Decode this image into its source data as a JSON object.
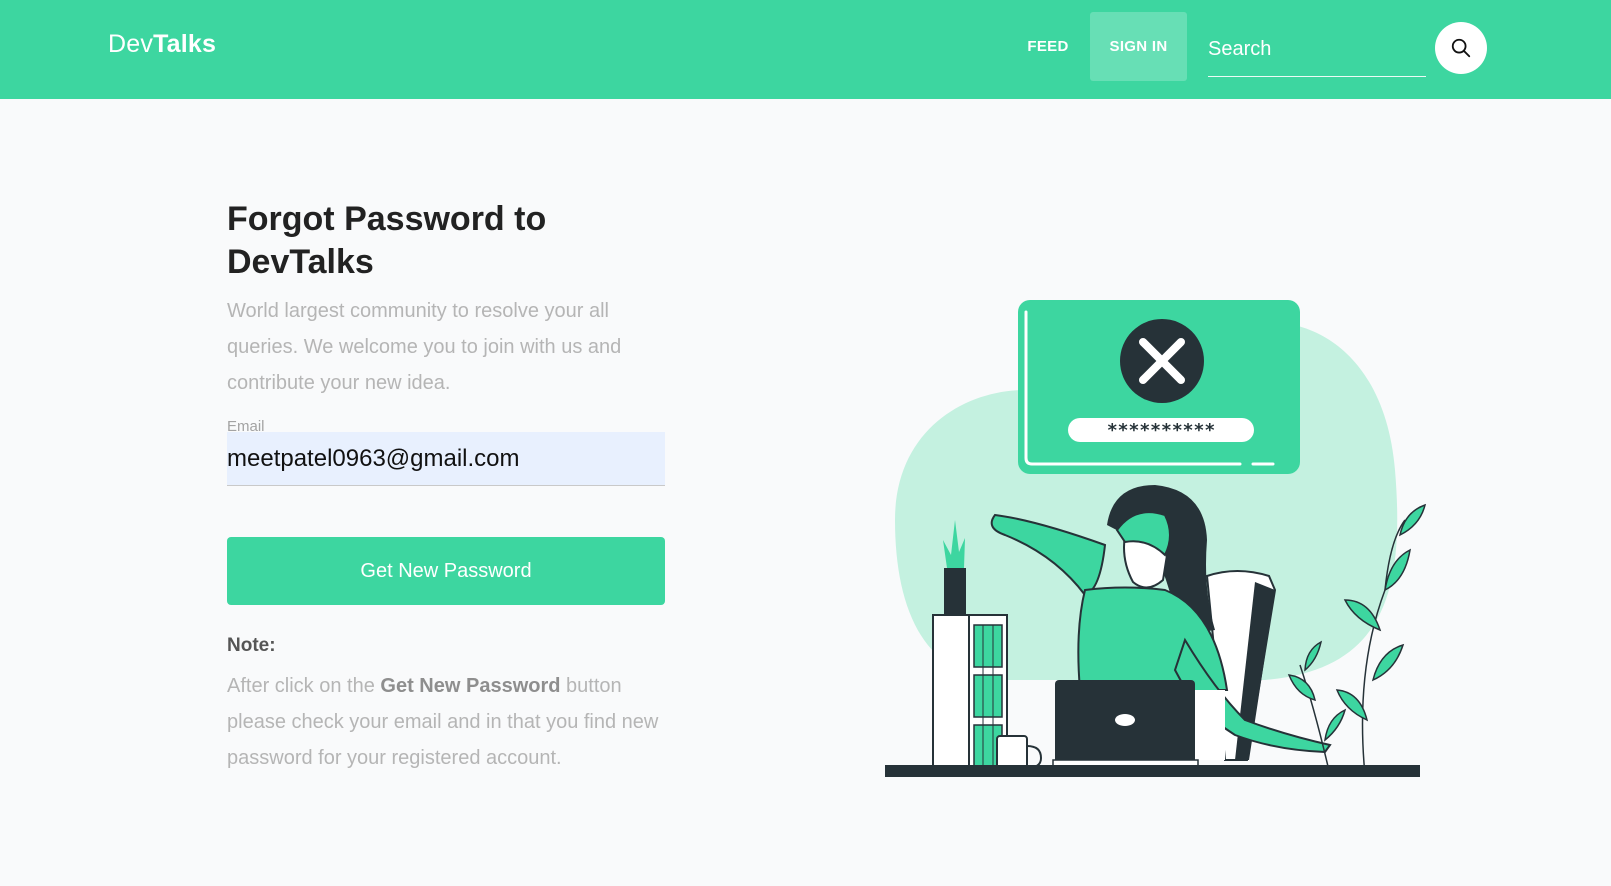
{
  "navbar": {
    "brand_part1": "Dev",
    "brand_part2": "Talks",
    "feed_label": "FEED",
    "signin_label": "SIGN IN",
    "search_placeholder": "Search",
    "search_icon": "search-icon"
  },
  "form": {
    "title": "Forgot Password to DevTalks",
    "subtitle": "World largest community to resolve your all queries. We welcome you to join with us and contribute your new idea.",
    "email_label": "Email",
    "email_value": "meetpatel0963@gmail.com",
    "submit_label": "Get New Password"
  },
  "note": {
    "label": "Note:",
    "text_before": "After click on the ",
    "text_bold": "Get New Password",
    "text_after": " button please check your email and in that you find new password for your registered account."
  },
  "illustration": {
    "password_mask": "**********"
  },
  "colors": {
    "primary": "#3dd6a0",
    "light_primary": "#c4f1e0",
    "dark": "#263238"
  }
}
